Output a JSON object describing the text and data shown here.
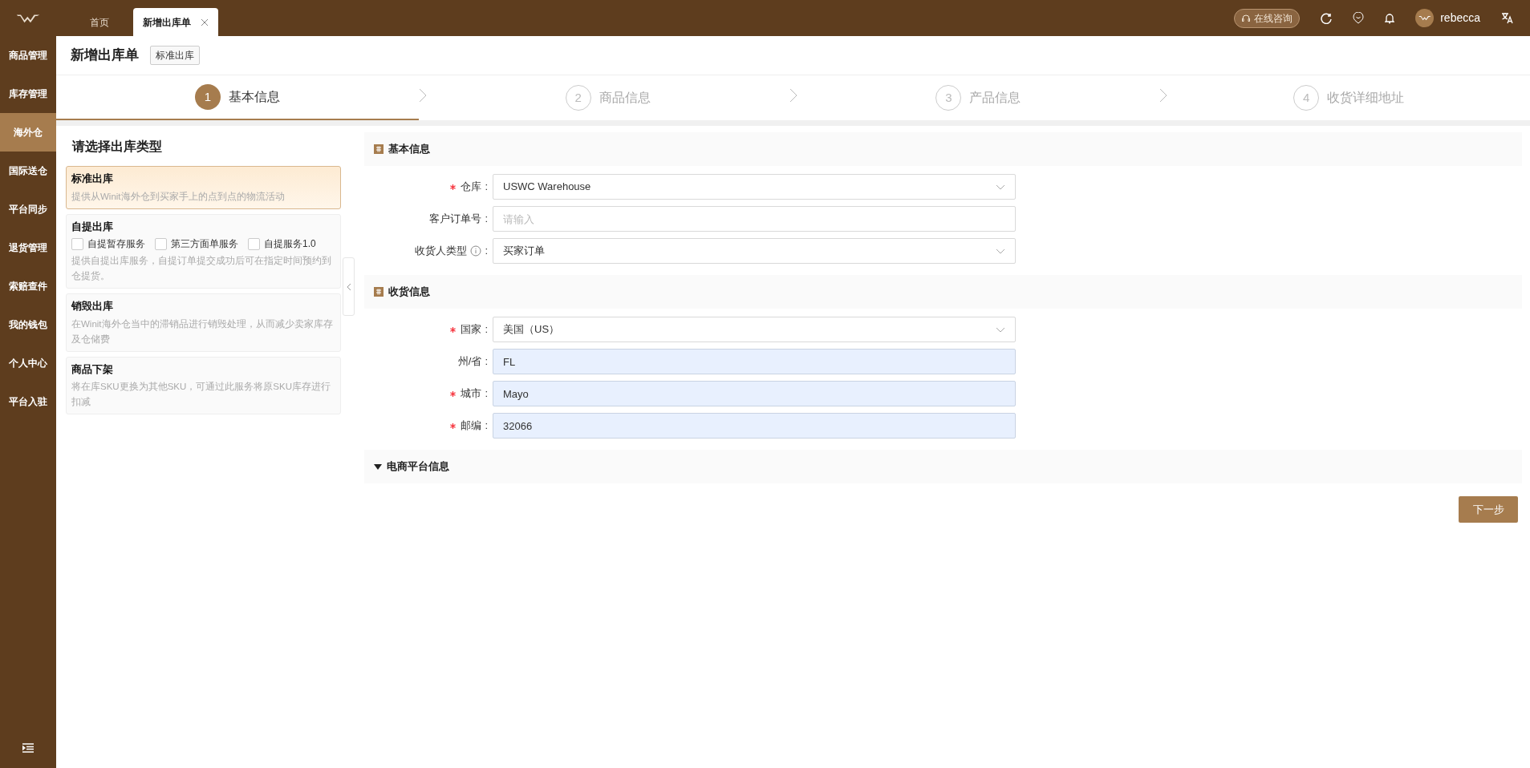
{
  "top_bar": {
    "tabs": [
      {
        "label": "首页",
        "selected": false,
        "closable": false
      },
      {
        "label": "新增出库单",
        "selected": true,
        "closable": true
      }
    ],
    "consult_button": "在线咨询",
    "username": "rebecca"
  },
  "sidebar": {
    "items": [
      {
        "label": "商品管理",
        "selected": false
      },
      {
        "label": "库存管理",
        "selected": false
      },
      {
        "label": "海外仓",
        "selected": true
      },
      {
        "label": "国际送仓",
        "selected": false
      },
      {
        "label": "平台同步",
        "selected": false
      },
      {
        "label": "退货管理",
        "selected": false
      },
      {
        "label": "索赔查件",
        "selected": false
      },
      {
        "label": "我的钱包",
        "selected": false
      },
      {
        "label": "个人中心",
        "selected": false
      },
      {
        "label": "平台入驻",
        "selected": false
      }
    ]
  },
  "page_header": {
    "title": "新增出库单",
    "tag": "标准出库"
  },
  "steps": [
    {
      "number": "1",
      "label": "基本信息",
      "selected": true
    },
    {
      "number": "2",
      "label": "商品信息",
      "selected": false
    },
    {
      "number": "3",
      "label": "产品信息",
      "selected": false
    },
    {
      "number": "4",
      "label": "收货详细地址",
      "selected": false
    }
  ],
  "type_panel": {
    "title": "请选择出库类型",
    "options": [
      {
        "title": "标准出库",
        "description": "提供从Winit海外仓到买家手上的点到点的物流活动",
        "selected": true
      },
      {
        "title": "自提出库",
        "description": "提供自提出库服务，自提订单提交成功后可在指定时间预约到仓提货。",
        "selected": false,
        "checkboxes": [
          {
            "label": "自提暂存服务",
            "checked": false
          },
          {
            "label": "第三方面单服务",
            "checked": false
          },
          {
            "label": "自提服务1.0",
            "checked": false
          }
        ]
      },
      {
        "title": "销毁出库",
        "description": "在Winit海外仓当中的滞销品进行销毁处理，从而减少卖家库存及仓储费",
        "selected": false
      },
      {
        "title": "商品下架",
        "description": "将在库SKU更换为其他SKU，可通过此服务将原SKU库存进行扣减",
        "selected": false
      }
    ]
  },
  "form_sections": [
    {
      "title": "基本信息",
      "kind": "box",
      "fields": [
        {
          "label": "仓库",
          "colon": ":",
          "required": true,
          "info": false,
          "kind": "select",
          "value": "USWC Warehouse",
          "autofilled": false
        },
        {
          "label": "客户订单号",
          "colon": ":",
          "required": false,
          "info": false,
          "kind": "input",
          "placeholder": "请输入",
          "autofilled": false
        },
        {
          "label": "收货人类型",
          "colon": ":",
          "required": false,
          "info": true,
          "kind": "select",
          "value": "买家订单",
          "autofilled": false
        }
      ]
    },
    {
      "title": "收货信息",
      "kind": "box",
      "fields": [
        {
          "label": "国家",
          "colon": ":",
          "required": true,
          "info": false,
          "kind": "select",
          "value": "美国（US）",
          "autofilled": false
        },
        {
          "label": "州/省",
          "colon": ":",
          "required": false,
          "info": false,
          "kind": "input",
          "value": "FL",
          "autofilled": true
        },
        {
          "label": "城市",
          "colon": ":",
          "required": true,
          "info": false,
          "kind": "input",
          "value": "Mayo",
          "autofilled": true
        },
        {
          "label": "邮编",
          "colon": ":",
          "required": true,
          "info": false,
          "kind": "input",
          "value": "32066",
          "autofilled": true
        }
      ]
    },
    {
      "title": "电商平台信息",
      "kind": "collapsible",
      "expanded": false
    }
  ],
  "next_button": "下一步"
}
